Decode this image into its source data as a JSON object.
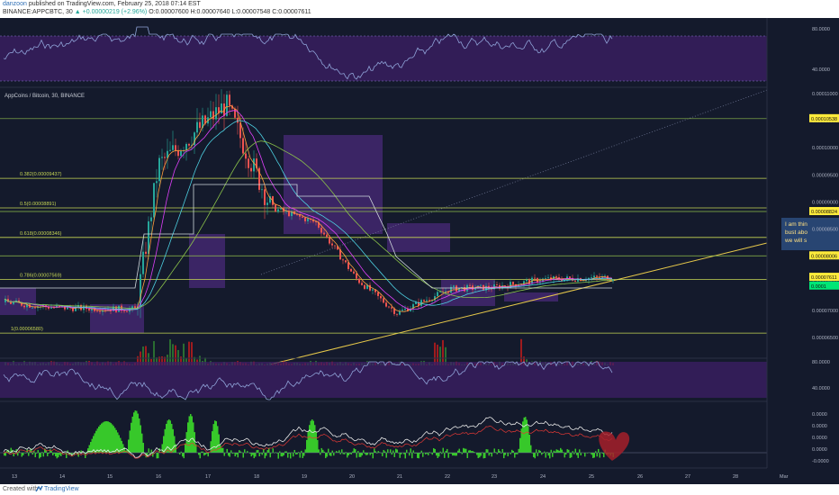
{
  "header": {
    "author": "danzoon",
    "published": "published on TradingView.com, February 25, 2018 07:14 EST",
    "symbol": "BINANCE:APPCBTC, 30",
    "change": "▲ +0.00000219 (+2.96%)",
    "ohlc": "O:0.00007600 H:0.00007640 L:0.00007548 C:0.00007611"
  },
  "main": {
    "title": "AppCoins / Bitcoin, 30, BINANCE"
  },
  "fib": [
    {
      "label": "0.382(0.00009437)",
      "value": 9.437e-05
    },
    {
      "label": "0.5(0.00008891)",
      "value": 8.891e-05
    },
    {
      "label": "0.618(0.00008346)",
      "value": 8.346e-05
    },
    {
      "label": "0.786(0.00007569)",
      "value": 7.569e-05
    },
    {
      "label": "1(0.00006580)",
      "value": 6.58e-05
    }
  ],
  "price_axis": {
    "ticks": [
      "0.00011000",
      "0.00010500",
      "0.00010000",
      "0.00009500",
      "0.00009000",
      "0.00008500",
      "0.00008000",
      "0.00007500",
      "0.00007000",
      "0.00006500"
    ],
    "badges": [
      {
        "text": "0.00010538",
        "value": 0.00010538,
        "color": "#ffeb3b"
      },
      {
        "text": "0.00008824",
        "value": 8.824e-05,
        "color": "#ffeb3b"
      },
      {
        "text": "0.00008006",
        "value": 8.006e-05,
        "color": "#ffeb3b"
      },
      {
        "text": "0.00007611",
        "value": 7.611e-05,
        "color": "#ffeb3b"
      },
      {
        "text": "0.0001",
        "value": 7.45e-05,
        "color": "#00e676"
      }
    ]
  },
  "annotation": [
    "I am thin",
    "bust abo",
    "we will s"
  ],
  "rsi_axis": [
    "80.0000",
    "40.0000"
  ],
  "rsi2_axis": [
    "80.0000",
    "40.0000"
  ],
  "macd_axis": [
    "0.0000",
    "0.0000",
    "0.0000",
    "0.0000",
    "-0.0000"
  ],
  "time_axis": [
    "13",
    "14",
    "15",
    "16",
    "17",
    "18",
    "19",
    "20",
    "21",
    "22",
    "23",
    "24",
    "25",
    "26",
    "27",
    "28",
    "Mar"
  ],
  "footer": {
    "label": "Created with",
    "brand": "TradingView"
  },
  "colors": {
    "background": "#141a2c",
    "fib_line": "#c6d654",
    "cloud": "#5b2f95",
    "trendline": "#e6c84a",
    "rsi_band": "#3c1f66",
    "macd_hist": "#37c82a",
    "heart": "#a5202a"
  },
  "chart_data": {
    "type": "line",
    "title": "AppCoins / Bitcoin, 30, BINANCE",
    "x": [
      "13",
      "14",
      "15",
      "16",
      "17",
      "18",
      "19",
      "20",
      "21",
      "22",
      "23",
      "24",
      "25"
    ],
    "series": [
      {
        "values": [
          7.15e-05,
          7.05e-05,
          7.02e-05,
          9.68e-05,
          0.000108,
          8.9e-05,
          8.62e-05,
          7.58e-05,
          6.95e-05,
          7.4e-05,
          7.42e-05,
          7.57e-05,
          7.61e-05
        ]
      }
    ],
    "ylim": [
      6.25e-05,
      0.000111
    ],
    "grid": false
  }
}
